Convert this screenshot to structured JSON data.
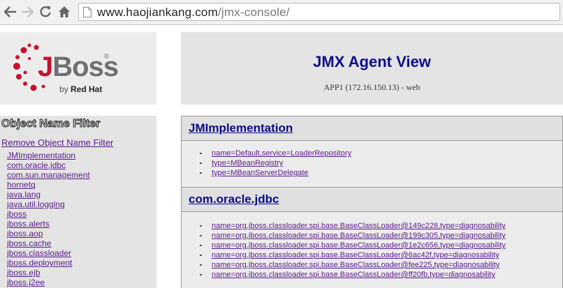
{
  "browser": {
    "url_host": "www.haojiankang.com",
    "url_path": "/jmx-console/"
  },
  "logo": {
    "brand": "JBoss",
    "brand_first": "J",
    "brand_rest": "Boss",
    "registered": "®",
    "byline_by": "by ",
    "byline_company": "Red Hat"
  },
  "header": {
    "title": "JMX Agent View",
    "subtitle": "APP1 (172.16.150.13) - web"
  },
  "sidebar": {
    "heading": "Object Name Filter",
    "remove_filter": "Remove Object Name Filter",
    "domains": [
      "JMImplementation",
      "com.oracle.jdbc",
      "com.sun.management",
      "hornetq",
      "java.lang",
      "java.util.logging",
      "jboss",
      "jboss.alerts",
      "jboss.aop",
      "jboss.cache",
      "jboss.classloader",
      "jboss.deployment",
      "jboss.ejb",
      "jboss.j2ee"
    ]
  },
  "sections": [
    {
      "title": "JMImplementation",
      "mbeans": [
        "name=Default,service=LoaderRepository",
        "type=MBeanRegistry",
        "type=MBeanServerDelegate"
      ]
    },
    {
      "title": "com.oracle.jdbc",
      "mbeans": [
        "name=org.jboss.classloader.spi.base.BaseClassLoader@149c228,type=diagnosability",
        "name=org.jboss.classloader.spi.base.BaseClassLoader@199c305,type=diagnosability",
        "name=org.jboss.classloader.spi.base.BaseClassLoader@1e2c656,type=diagnosability",
        "name=org.jboss.classloader.spi.base.BaseClassLoader@6ac42f,type=diagnosability",
        "name=org.jboss.classloader.spi.base.BaseClassLoader@fee225,type=diagnosability",
        "name=org.jboss.classloader.spi.base.BaseClassLoader@ff20fb,type=diagnosability"
      ]
    }
  ],
  "colors": {
    "link_visited": "#5a1a8a",
    "heading_blue": "#0d0d8c",
    "jboss_red": "#c4122e"
  }
}
